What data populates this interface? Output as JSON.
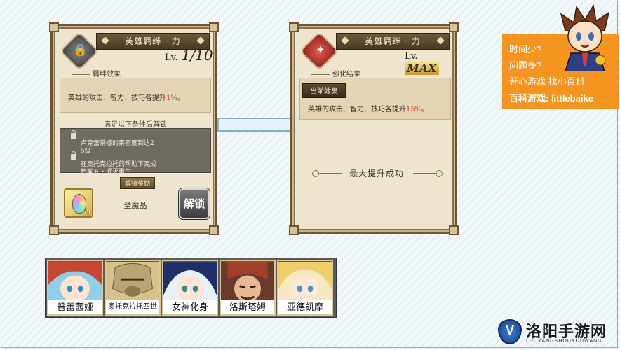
{
  "left_panel": {
    "title": "英雄羁绊 · 力",
    "level_prefix": "Lv.",
    "level_value": "1/10",
    "bond_effect_header": "羁绊效果",
    "effect_text": "英雄的攻击、智力、技巧各提升",
    "effect_percent": "1%",
    "effect_suffix": "。",
    "unlock_condition_header": "满足以下条件后解锁",
    "conditions": [
      "卢克蕾蒂娅的亲密度到达2\n5级",
      "在奥托克拉托的帮助下完成\n档案五・泯灭重生"
    ],
    "reward_label": "解锁奖励",
    "reward_item_name": "圣魔晶",
    "reward_count": "/5",
    "unlock_button": "解锁"
  },
  "right_panel": {
    "title": "英雄羁绊 · 力",
    "level_prefix": "Lv.",
    "level_value": "MAX",
    "enhance_result_header": "强化结果",
    "current_effect_label": "当前效果",
    "effect_text": "英雄的攻击、智力、技巧各提升",
    "effect_percent": "15%",
    "effect_suffix": "。",
    "max_message": "最大提升成功"
  },
  "promo": {
    "line1": "时间少?",
    "line2": "问题多?",
    "line3": "开心游戏 找小百科",
    "line4": "百科游戏: littlebaike"
  },
  "heroes": [
    {
      "name": "普蕾茜娅"
    },
    {
      "name": "奥托克拉托四世"
    },
    {
      "name": "女神化身"
    },
    {
      "name": "洛斯塔姆"
    },
    {
      "name": "亚德凯摩"
    }
  ],
  "watermark": {
    "title": "洛阳手游网",
    "subtitle": "LUOYANGSHOUYOUWANG"
  },
  "colors": {
    "accent_red": "#d6312a",
    "promo_orange": "#f5951f",
    "parchment": "#efe5cf",
    "frame_brown": "#6b5637",
    "arrow_blue": "#7fb0cc"
  }
}
